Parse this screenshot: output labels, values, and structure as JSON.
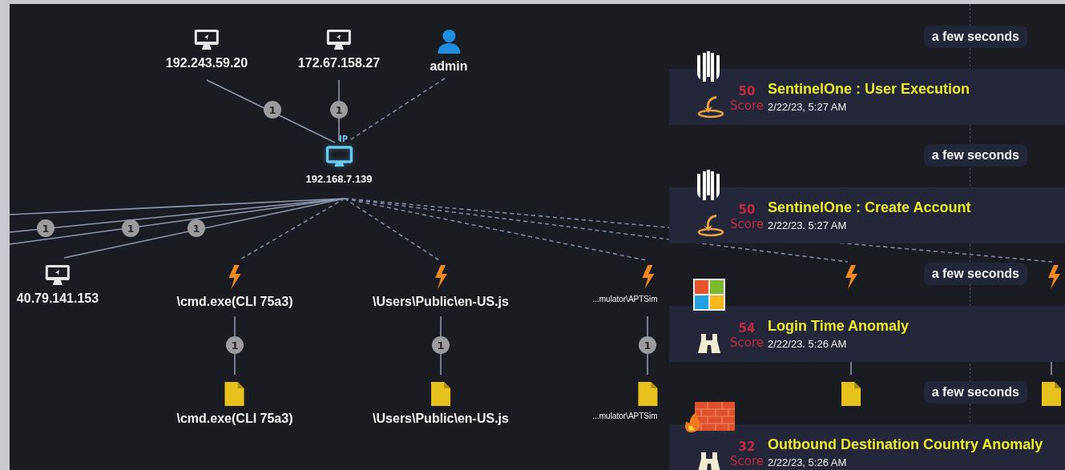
{
  "graph": {
    "nodes": [
      {
        "kind": "host",
        "label": "192.243.59.20",
        "selected": false
      },
      {
        "kind": "host",
        "label": "172.67.158.27",
        "selected": false
      },
      {
        "kind": "user",
        "label": "admin",
        "selected": false
      },
      {
        "kind": "host",
        "label": "192.168.7.139",
        "tag": "IP",
        "selected": true
      },
      {
        "kind": "host",
        "label": "40.79.141.153",
        "selected": false
      },
      {
        "kind": "process",
        "label": "\\cmd.exe(CLI 75a3)",
        "selected": false
      },
      {
        "kind": "process",
        "label": "\\Users\\Public\\en-US.js",
        "selected": false
      },
      {
        "kind": "process",
        "label": "...mulator\\APTSim",
        "truncated": true,
        "selected": false
      },
      {
        "kind": "process",
        "selected": false
      },
      {
        "kind": "process",
        "selected": false
      },
      {
        "kind": "file",
        "label": "\\cmd.exe(CLI 75a3)",
        "selected": false
      },
      {
        "kind": "file",
        "label": "\\Users\\Public\\en-US.js",
        "selected": false
      },
      {
        "kind": "file",
        "label": "...mulator\\APTSim",
        "truncated": true,
        "selected": false
      },
      {
        "kind": "file",
        "selected": false
      },
      {
        "kind": "file",
        "selected": false
      }
    ],
    "edges": [
      {
        "kind": "solid",
        "badge": "1"
      },
      {
        "kind": "solid",
        "badge": "1"
      },
      {
        "kind": "dashed"
      },
      {
        "kind": "solid",
        "badge": "1"
      },
      {
        "kind": "solid",
        "badge": "1"
      },
      {
        "kind": "solid",
        "badge": "1"
      },
      {
        "kind": "solid"
      },
      {
        "kind": "dashed"
      },
      {
        "kind": "dashed"
      },
      {
        "kind": "dashed"
      },
      {
        "kind": "dashed"
      },
      {
        "kind": "dashed"
      },
      {
        "kind": "solid",
        "badge": "1"
      },
      {
        "kind": "solid",
        "badge": "1"
      },
      {
        "kind": "solid",
        "badge": "1"
      },
      {
        "kind": "solid"
      },
      {
        "kind": "solid"
      }
    ]
  },
  "timeline": [
    {
      "time_ago": "a few seconds",
      "logo": {
        "kind": "stripes"
      },
      "detector": {
        "kind": "hook"
      },
      "score": "50",
      "score_label": "Score",
      "title": "SentinelOne : User Execution",
      "date": "2/22/23, 5:27 AM"
    },
    {
      "time_ago": "a few seconds",
      "logo": {
        "kind": "stripes"
      },
      "detector": {
        "kind": "hook"
      },
      "score": "50",
      "score_label": "Score",
      "title": "SentinelOne : Create Account",
      "date": "2/22/23. 5:27 AM"
    },
    {
      "time_ago": "a few seconds",
      "logo": {
        "kind": "four-squares"
      },
      "detector": {
        "kind": "binoculars"
      },
      "score": "54",
      "score_label": "Score",
      "title": "Login Time Anomaly",
      "date": "2/22/23. 5:26 AM"
    },
    {
      "time_ago": "a few seconds",
      "logo": {
        "kind": "brick-wall"
      },
      "detector": {
        "kind": "binoculars"
      },
      "score": "32",
      "score_label": "Score",
      "title": "Outbound Destination Country Anomaly",
      "date": "2/22/23, 5:26 AM"
    }
  ]
}
